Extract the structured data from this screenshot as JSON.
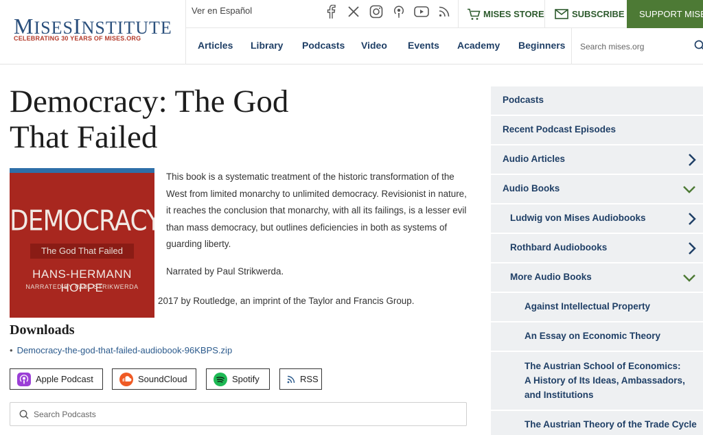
{
  "header": {
    "logo_mises": "MISES",
    "logo_institute": "INSTITUTE",
    "tagline": "CELEBRATING 30 YEARS OF MISES.ORG",
    "lang_link": "Ver en Español",
    "social_icons": [
      "facebook-icon",
      "x-icon",
      "instagram-icon",
      "podcast-icon",
      "youtube-icon",
      "rss-icon"
    ],
    "store_label": "MISES STORE",
    "subscribe_label": "SUBSCRIBE",
    "support_label": "SUPPORT MISES",
    "nav": [
      "Articles",
      "Library",
      "Podcasts",
      "Video",
      "Events",
      "Academy",
      "Beginners"
    ],
    "search_placeholder": "Search mises.org",
    "colors": {
      "brand_blue": "#2a4f7c",
      "tagline_red": "#b33a2a",
      "support_green": "#4d7a35",
      "nav_blue": "#1f3f66"
    }
  },
  "main": {
    "title": "Democracy: The God That Failed",
    "cover": {
      "title": "DEMOCRACY",
      "subtitle": "The God That Failed",
      "author": "HANS-HERMANN HOPPE",
      "narrator": "NARRATED BY PAUL STRIKWERDA"
    },
    "description": "This book is a systematic treatment of the historic transformation of the West from limited monarchy to unlimited democracy. Revisionist in nature, it reaches the conclusion that monarchy, with all its failings, is a lesser evil than mass democracy, but outlines deficiencies in both as systems of guarding liberty.",
    "narrated": "Narrated by Paul Strikwerda.",
    "publisher": "2017 by Routledge, an imprint of the Taylor and Francis Group.",
    "downloads_heading": "Downloads",
    "download_file": "Democracy-the-god-that-failed-audiobook-96KBPS.zip",
    "platforms": [
      "Apple Podcast",
      "SoundCloud",
      "Spotify",
      "RSS"
    ],
    "search_placeholder": "Search Podcasts"
  },
  "sidebar": {
    "items": [
      {
        "label": "Podcasts",
        "chevron": "none"
      },
      {
        "label": "Recent Podcast Episodes",
        "chevron": "none"
      },
      {
        "label": "Audio Articles",
        "chevron": "right"
      },
      {
        "label": "Audio Books",
        "chevron": "down"
      },
      {
        "label": "Ludwig von Mises Audiobooks",
        "chevron": "right"
      },
      {
        "label": "Rothbard Audiobooks",
        "chevron": "right"
      },
      {
        "label": "More Audio Books",
        "chevron": "down"
      },
      {
        "label": "Against Intellectual Property",
        "chevron": "none"
      },
      {
        "label": "An Essay on Economic Theory",
        "chevron": "none"
      },
      {
        "label": "The Austrian School of Economics: A History of Its Ideas, Ambassadors, and Institutions",
        "chevron": "none"
      },
      {
        "label": "The Austrian Theory of the Trade Cycle",
        "chevron": "none"
      }
    ],
    "colors": {
      "bg": "#eef0f2",
      "link": "#1f3f66",
      "chevron_blue": "#1f3f66",
      "chevron_green": "#4d7a35"
    }
  }
}
